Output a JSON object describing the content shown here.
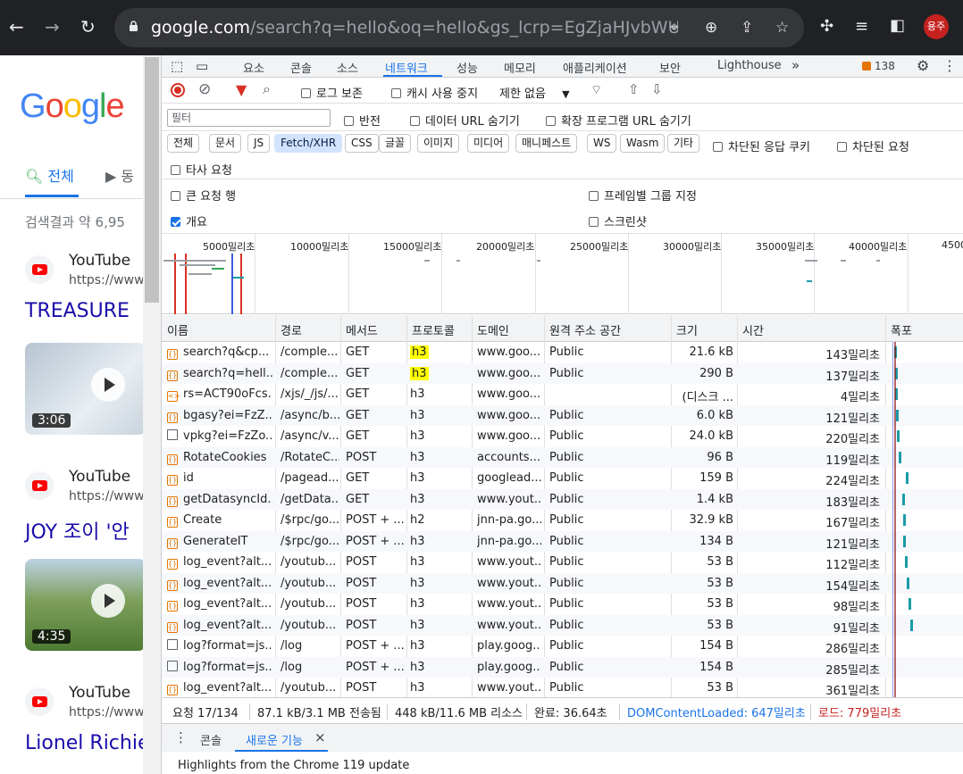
{
  "browser": {
    "url_host": "google.com",
    "url_rest": "/search?q=hello&oq=hello&gs_lcrp=EgZjaHJvbWUqEAgA...",
    "profile_label": "용주"
  },
  "google": {
    "tab_all": "전체",
    "tab_video": "동",
    "result_count": "검색결과 약 6,95",
    "results": [
      {
        "site": "YouTube",
        "url": "https://www.y",
        "title": "TREASURE"
      },
      {
        "site": "YouTube",
        "url": "https://www.y",
        "title": "JOY 조이 '안"
      },
      {
        "site": "YouTube",
        "url": "https://www.y",
        "title": "Lionel Richie"
      }
    ],
    "durations": [
      "3:06",
      "4:35"
    ]
  },
  "devtools": {
    "tabs": [
      "요소",
      "콘솔",
      "소스",
      "네트워크",
      "성능",
      "메모리",
      "애플리케이션",
      "보안",
      "Lighthouse"
    ],
    "more": "»",
    "issues_count": "138",
    "toolbar": {
      "preserve_log": "로그 보존",
      "disable_cache": "캐시 사용 중지",
      "throttle": "제한 없음"
    },
    "filter": {
      "placeholder": "필터",
      "invert": "반전",
      "hide_data_url": "데이터 URL 숨기기",
      "hide_ext_url": "확장 프로그램 URL 숨기기"
    },
    "types": [
      "전체",
      "문서",
      "JS",
      "Fetch/XHR",
      "CSS",
      "글꼴",
      "이미지",
      "미디어",
      "매니페스트",
      "WS",
      "Wasm",
      "기타"
    ],
    "blocked_cookies": "차단된 응답 쿠키",
    "blocked_requests": "차단된 요청",
    "third_party": "타사 요청",
    "big_rows": "큰 요청 행",
    "group_by_frame": "프레임별 그룹 지정",
    "overview": "개요",
    "screenshots": "스크린샷",
    "timeline_labels": [
      "5000밀리초",
      "10000밀리초",
      "15000밀리초",
      "20000밀리초",
      "25000밀리초",
      "30000밀리초",
      "35000밀리초",
      "40000밀리초",
      "4500"
    ],
    "columns": [
      "이름",
      "경로",
      "메서드",
      "프로토콜",
      "도메인",
      "원격 주소 공간",
      "크기",
      "시간",
      "폭포"
    ],
    "rows": [
      {
        "icon": "{}",
        "name": "search?q&cp...",
        "path": "/comple...",
        "method": "GET",
        "protocol": "h3",
        "domain": "www.goo...",
        "space": "Public",
        "size": "21.6 kB",
        "time": "143밀리초"
      },
      {
        "icon": "{}",
        "name": "search?q=hell...",
        "path": "/comple...",
        "method": "GET",
        "protocol": "h3",
        "domain": "www.goo...",
        "space": "Public",
        "size": "290 B",
        "time": "137밀리초"
      },
      {
        "icon": "<>",
        "name": "rs=ACT90oFcs...",
        "path": "/xjs/_/js/...",
        "method": "GET",
        "protocol": "h3",
        "domain": "www.goo...",
        "space": "",
        "size": "(디스크 ...",
        "time": "4밀리초"
      },
      {
        "icon": "{}",
        "name": "bgasy?ei=FzZ...",
        "path": "/async/b...",
        "method": "GET",
        "protocol": "h3",
        "domain": "www.goo...",
        "space": "Public",
        "size": "6.0 kB",
        "time": "121밀리초"
      },
      {
        "icon": "doc",
        "name": "vpkg?ei=FzZo...",
        "path": "/async/v...",
        "method": "GET",
        "protocol": "h3",
        "domain": "www.goo...",
        "space": "Public",
        "size": "24.0 kB",
        "time": "220밀리초"
      },
      {
        "icon": "{}",
        "name": "RotateCookies",
        "path": "/RotateC...",
        "method": "POST",
        "protocol": "h3",
        "domain": "accounts....",
        "space": "Public",
        "size": "96 B",
        "time": "119밀리초"
      },
      {
        "icon": "{}",
        "name": "id",
        "path": "/pagead...",
        "method": "GET",
        "protocol": "h3",
        "domain": "googlead...",
        "space": "Public",
        "size": "159 B",
        "time": "224밀리초"
      },
      {
        "icon": "{}",
        "name": "getDatasyncId...",
        "path": "/getData...",
        "method": "GET",
        "protocol": "h3",
        "domain": "www.yout...",
        "space": "Public",
        "size": "1.4 kB",
        "time": "183밀리초"
      },
      {
        "icon": "{}",
        "name": "Create",
        "path": "/$rpc/go...",
        "method": "POST + ...",
        "protocol": "h2",
        "domain": "jnn-pa.go...",
        "space": "Public",
        "size": "32.9 kB",
        "time": "167밀리초"
      },
      {
        "icon": "{}",
        "name": "GenerateIT",
        "path": "/$rpc/go...",
        "method": "POST + ...",
        "protocol": "h3",
        "domain": "jnn-pa.go...",
        "space": "Public",
        "size": "134 B",
        "time": "121밀리초"
      },
      {
        "icon": "{}",
        "name": "log_event?alt...",
        "path": "/youtub...",
        "method": "POST",
        "protocol": "h3",
        "domain": "www.yout...",
        "space": "Public",
        "size": "53 B",
        "time": "112밀리초"
      },
      {
        "icon": "{}",
        "name": "log_event?alt...",
        "path": "/youtub...",
        "method": "POST",
        "protocol": "h3",
        "domain": "www.yout...",
        "space": "Public",
        "size": "53 B",
        "time": "154밀리초"
      },
      {
        "icon": "{}",
        "name": "log_event?alt...",
        "path": "/youtub...",
        "method": "POST",
        "protocol": "h3",
        "domain": "www.yout...",
        "space": "Public",
        "size": "53 B",
        "time": "98밀리초"
      },
      {
        "icon": "{}",
        "name": "log_event?alt...",
        "path": "/youtub...",
        "method": "POST",
        "protocol": "h3",
        "domain": "www.yout...",
        "space": "Public",
        "size": "53 B",
        "time": "91밀리초"
      },
      {
        "icon": "doc",
        "name": "log?format=js...",
        "path": "/log",
        "method": "POST + ...",
        "protocol": "h3",
        "domain": "play.goog...",
        "space": "Public",
        "size": "154 B",
        "time": "286밀리초"
      },
      {
        "icon": "doc",
        "name": "log?format=js...",
        "path": "/log",
        "method": "POST + ...",
        "protocol": "h3",
        "domain": "play.goog...",
        "space": "Public",
        "size": "154 B",
        "time": "285밀리초"
      },
      {
        "icon": "{}",
        "name": "log_event?alt...",
        "path": "/youtub...",
        "method": "POST",
        "protocol": "h3",
        "domain": "www.yout...",
        "space": "Public",
        "size": "53 B",
        "time": "361밀리초"
      }
    ],
    "status": {
      "requests": "요청 17/134",
      "transferred": "87.1 kB/3.1 MB 전송됨",
      "resources": "448 kB/11.6 MB 리소스",
      "finish": "완료: 36.64초",
      "dcl": "DOMContentLoaded: 647밀리초",
      "load": "로드: 779밀리초"
    },
    "drawer": {
      "console": "콘솔",
      "whats_new": "새로운 기능",
      "close": "×",
      "highlights": "Highlights from the Chrome 119 update"
    }
  },
  "colors": {
    "accent": "#1a73e8",
    "highlight": "#ffff00",
    "load": "#c5221f"
  }
}
